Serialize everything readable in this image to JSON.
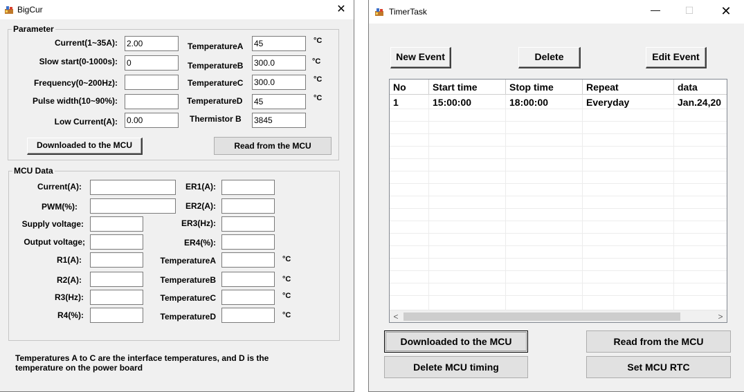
{
  "bigcur": {
    "title": "BigCur",
    "close_glyph": "✕",
    "parameter": {
      "legend": "Parameter",
      "fields": [
        {
          "label": "Current(1~35A):",
          "value": "2.00"
        },
        {
          "label": "Slow start(0-1000s):",
          "value": "0"
        },
        {
          "label": "Frequency(0~200Hz):",
          "value": ""
        },
        {
          "label": "Pulse width(10~90%):",
          "value": ""
        },
        {
          "label": "Low Current(A):",
          "value": "0.00"
        }
      ],
      "temps": [
        {
          "label": "TemperatureA",
          "value": "45",
          "unit": "°C"
        },
        {
          "label": "TemperatureB",
          "value": "300.0",
          "unit": "°C"
        },
        {
          "label": "TemperatureC",
          "value": "300.0",
          "unit": "°C"
        },
        {
          "label": "TemperatureD",
          "value": "45",
          "unit": "°C"
        },
        {
          "label": "Thermistor B",
          "value": "3845",
          "unit": ""
        }
      ],
      "download_button": "Downloaded to the MCU",
      "read_button": "Read from the MCU"
    },
    "mcu_data": {
      "legend": "MCU Data",
      "left": [
        {
          "label": "Current(A):",
          "value": ""
        },
        {
          "label": "PWM(%):",
          "value": ""
        },
        {
          "label": "Supply voltage:",
          "value": ""
        },
        {
          "label": "Output voltage;",
          "value": ""
        },
        {
          "label": "R1(A):",
          "value": ""
        },
        {
          "label": "R2(A):",
          "value": ""
        },
        {
          "label": "R3(Hz):",
          "value": ""
        },
        {
          "label": "R4(%):",
          "value": ""
        }
      ],
      "right": [
        {
          "label": "ER1(A):",
          "value": "",
          "unit": ""
        },
        {
          "label": "ER2(A):",
          "value": "",
          "unit": ""
        },
        {
          "label": "ER3(Hz):",
          "value": "",
          "unit": ""
        },
        {
          "label": "ER4(%):",
          "value": "",
          "unit": ""
        },
        {
          "label": "TemperatureA",
          "value": "",
          "unit": "°C"
        },
        {
          "label": "TemperatureB",
          "value": "",
          "unit": "°C"
        },
        {
          "label": "TemperatureC",
          "value": "",
          "unit": "°C"
        },
        {
          "label": "TemperatureD",
          "value": "",
          "unit": "°C"
        }
      ]
    },
    "note": "Temperatures A to C are the interface temperatures, and D is the temperature on the power board"
  },
  "timertask": {
    "title": "TimerTask",
    "min_glyph": "—",
    "max_glyph": "☐",
    "close_glyph": "✕",
    "new_event_button": "New Event",
    "delete_button": "Delete",
    "edit_event_button": "Edit Event",
    "columns": [
      "No",
      "Start time",
      "Stop time",
      "Repeat",
      "data"
    ],
    "rows": [
      [
        "1",
        "15:00:00",
        "18:00:00",
        "Everyday",
        "Jan.24,20"
      ]
    ],
    "scroll_left": "<",
    "scroll_right": ">",
    "download_button": "Downloaded to the MCU",
    "read_button": "Read from the MCU",
    "delete_timing_button": "Delete MCU timing",
    "set_rtc_button": "Set MCU RTC"
  }
}
